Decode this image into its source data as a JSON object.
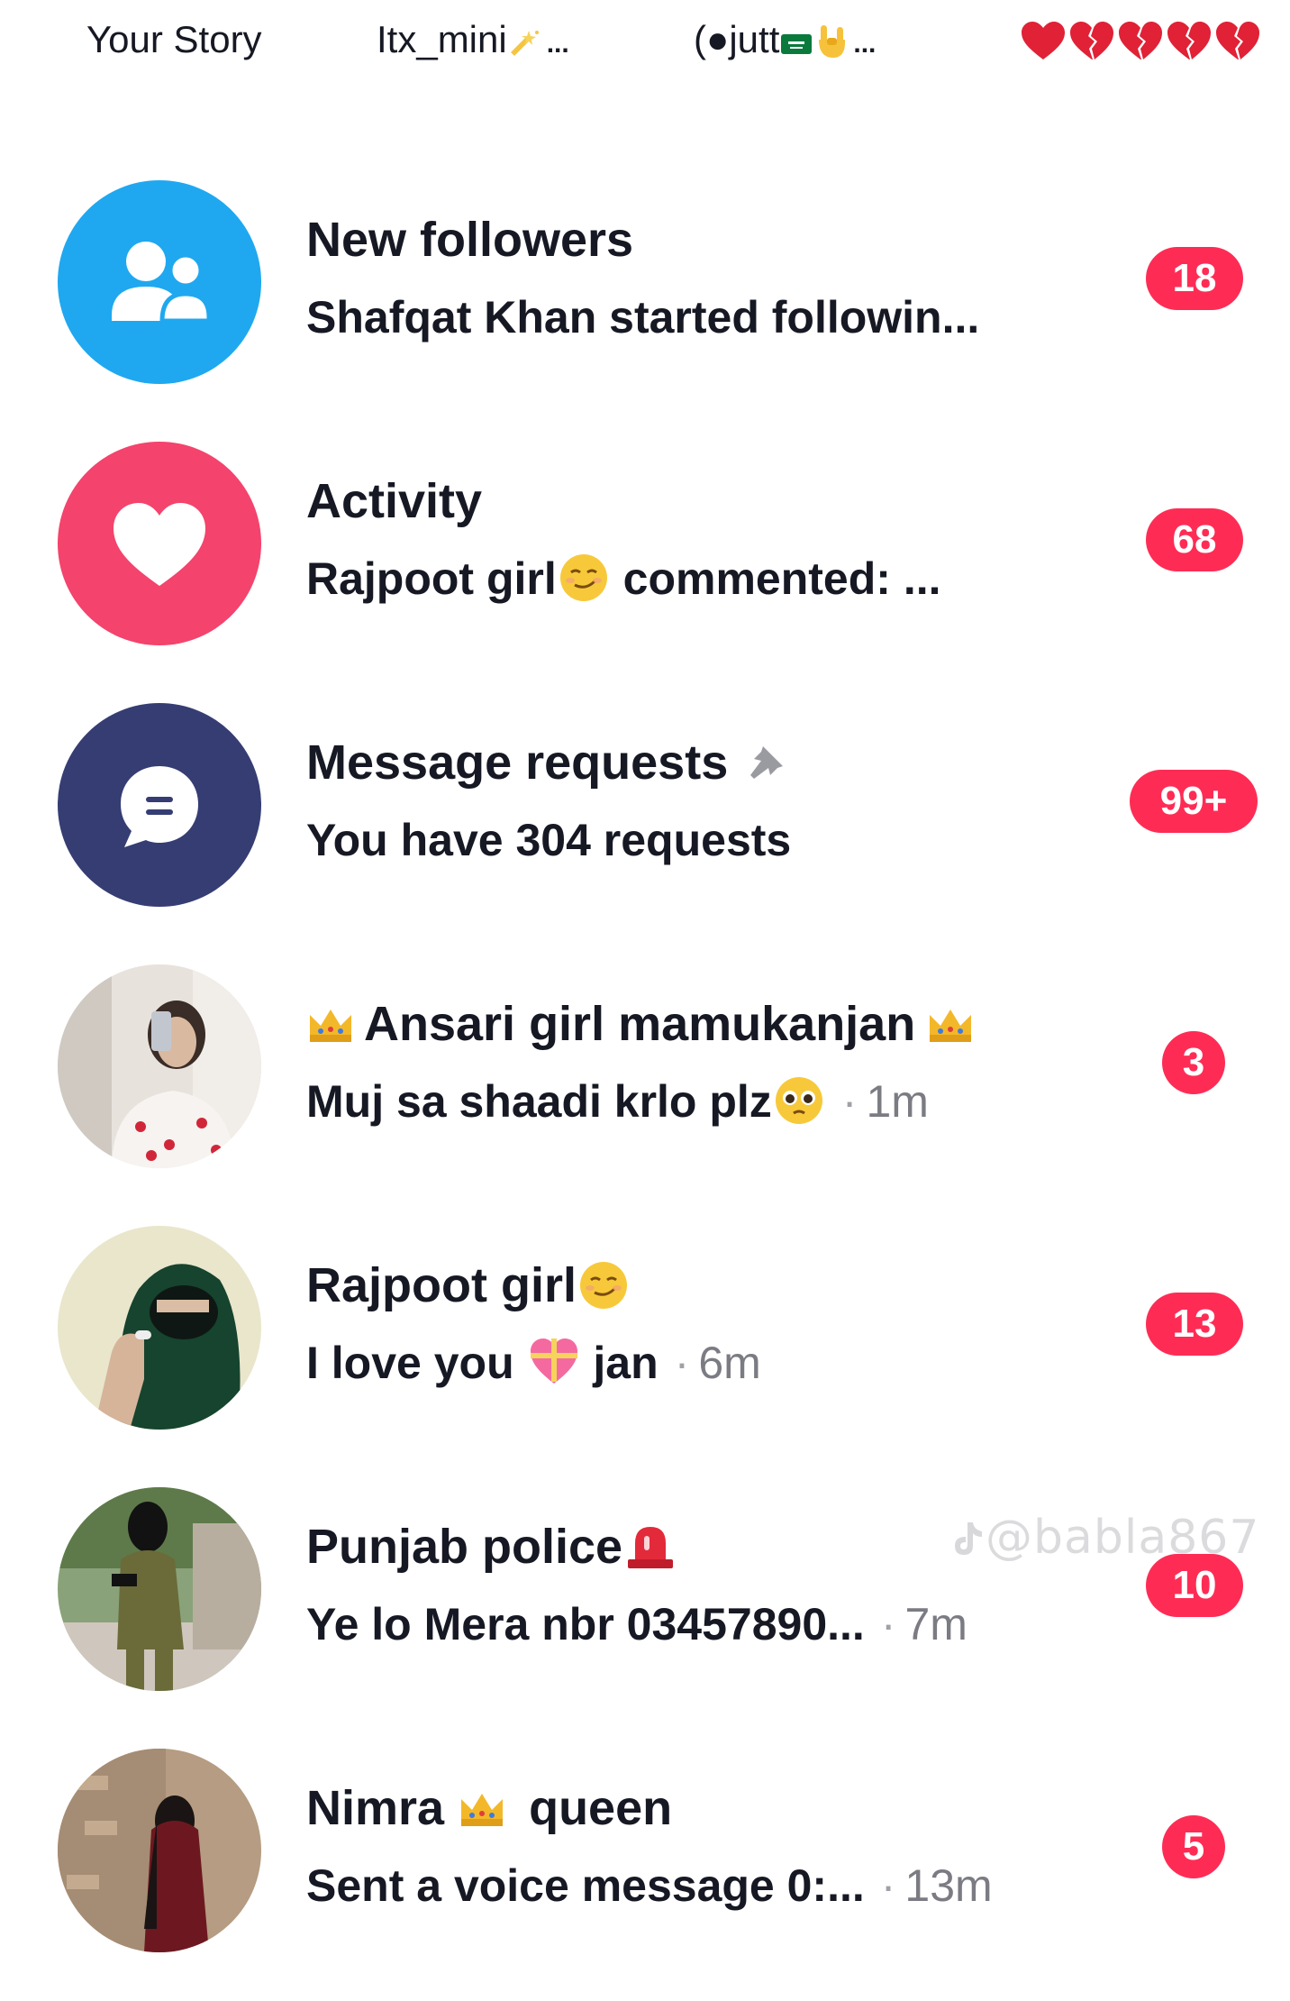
{
  "stories": [
    {
      "label": "Your Story"
    },
    {
      "label": "Itx_mini",
      "suffix": "..."
    },
    {
      "label": "(●jutt",
      "suffix": "..."
    },
    {
      "label": ""
    }
  ],
  "story_hearts_icon": "heart-row-icon",
  "rows": [
    {
      "kind": "system",
      "title": "New followers",
      "subtitle": "Shafqat Khan started followin...",
      "time": "",
      "badge": "18",
      "avatar_icon": "followers-icon",
      "avatar_color": "#1fa8f0"
    },
    {
      "kind": "system",
      "title": "Activity",
      "subtitle_prefix": "Rajpoot girl",
      "subtitle_suffix": " commented: ...",
      "time": "",
      "badge": "68",
      "avatar_icon": "heart-icon",
      "avatar_color": "#f4436c"
    },
    {
      "kind": "system",
      "title": "Message requests",
      "subtitle": "You have 304 requests",
      "time": "",
      "badge": "99+",
      "avatar_icon": "message-icon",
      "avatar_color": "#353d73",
      "pinned": true
    },
    {
      "kind": "chat",
      "title": "Ansari girl mamukanjan",
      "subtitle": "Muj sa shaadi krlo plz",
      "time": "1m",
      "badge": "3"
    },
    {
      "kind": "chat",
      "title": "Rajpoot girl",
      "subtitle_prefix": "I love you ",
      "subtitle_suffix": " jan",
      "time": "6m",
      "badge": "13"
    },
    {
      "kind": "chat",
      "title": "Punjab police",
      "subtitle": "Ye lo Mera nbr 03457890...",
      "time": "7m",
      "badge": "10"
    },
    {
      "kind": "chat",
      "title_prefix": "Nimra ",
      "title_suffix": " queen",
      "subtitle": "Sent a voice message 0:...",
      "time": "13m",
      "badge": "5"
    }
  ],
  "watermark": "@babla867",
  "colors": {
    "badge": "#fe2c55",
    "text": "#161823",
    "muted": "#7b7c83"
  }
}
